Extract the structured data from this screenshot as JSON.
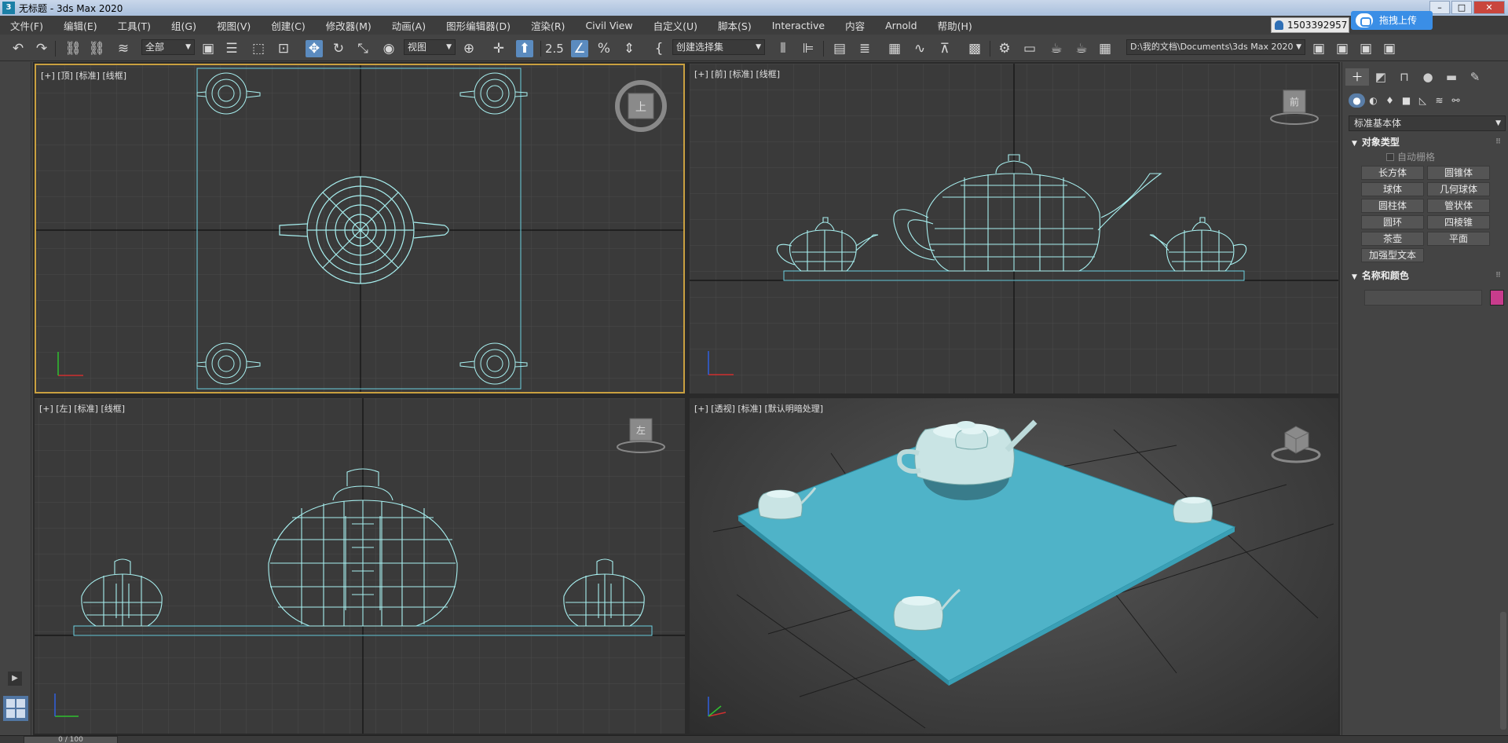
{
  "window": {
    "title": "无标题 - 3ds Max 2020",
    "app_icon_text": "3",
    "min_label": "–",
    "max_label": "□",
    "close_label": "✕"
  },
  "menu": [
    "文件(F)",
    "编辑(E)",
    "工具(T)",
    "组(G)",
    "视图(V)",
    "创建(C)",
    "修改器(M)",
    "动画(A)",
    "图形编辑器(D)",
    "渲染(R)",
    "Civil View",
    "自定义(U)",
    "脚本(S)",
    "Interactive",
    "内容",
    "Arnold",
    "帮助(H)"
  ],
  "account": {
    "user": "1503392957"
  },
  "upload": {
    "label": "拖拽上传"
  },
  "toolbar": {
    "selection_filter": "全部",
    "ref_coord": "视图",
    "named_selection": "创建选择集",
    "project_path": "D:\\我的文档\\Documents\\3ds Max 2020",
    "snap_value": "2.5"
  },
  "viewports": {
    "top": {
      "label": "[+] [顶] [标准] [线框]",
      "cube_face": "上",
      "active": true
    },
    "front": {
      "label": "[+] [前] [标准] [线框]",
      "cube_face": "前"
    },
    "left": {
      "label": "[+] [左] [标准] [线框]",
      "cube_face": "左"
    },
    "perspective": {
      "label": "[+] [透视] [标准] [默认明暗处理]"
    }
  },
  "command_panel": {
    "category": "标准基本体",
    "object_type_title": "对象类型",
    "autogrid": "自动栅格",
    "buttons": [
      "长方体",
      "圆锥体",
      "球体",
      "几何球体",
      "圆柱体",
      "管状体",
      "圆环",
      "四棱锥",
      "茶壶",
      "平面",
      "加强型文本"
    ],
    "name_color_title": "名称和颜色",
    "object_color": "#c83c8c"
  },
  "timeline": {
    "frame": "0 / 100"
  },
  "colors": {
    "wireframe": "#a8f0f0",
    "plane_shaded": "#4fb3c8",
    "viewport_bg": "#3a3a3a",
    "grid": "#4a4a4a"
  }
}
